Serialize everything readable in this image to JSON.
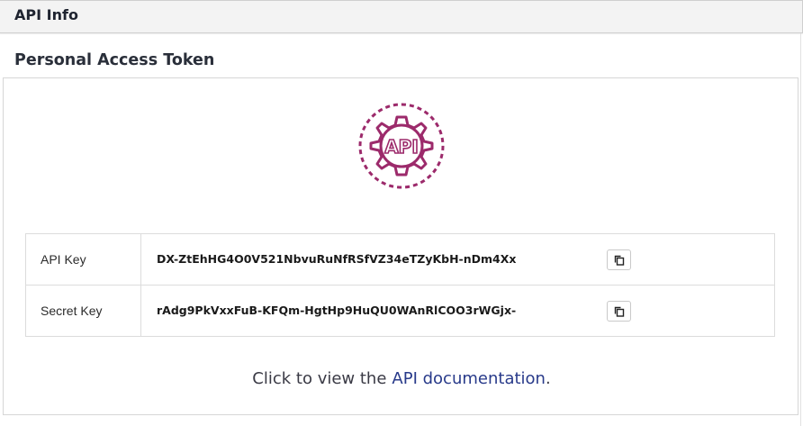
{
  "header": {
    "title": "API Info"
  },
  "section": {
    "title": "Personal Access Token"
  },
  "logo": {
    "icon": "api-gear-icon",
    "text": "API",
    "color": "#9c2a6b"
  },
  "keys": [
    {
      "label": "API Key",
      "value": "DX-ZtEhHG4O0V521NbvuRuNfRSfVZ34eTZyKbH-nDm4Xx",
      "copy_icon": "copy-icon"
    },
    {
      "label": "Secret Key",
      "value": "rAdg9PkVxxFuB-KFQm-HgtHp9HuQU0WAnRlCOO3rWGjx-",
      "copy_icon": "copy-icon"
    }
  ],
  "documentation": {
    "prefix": "Click to view the",
    "link_text": "API documentation",
    "suffix": ".",
    "link_color": "#283a8a"
  }
}
